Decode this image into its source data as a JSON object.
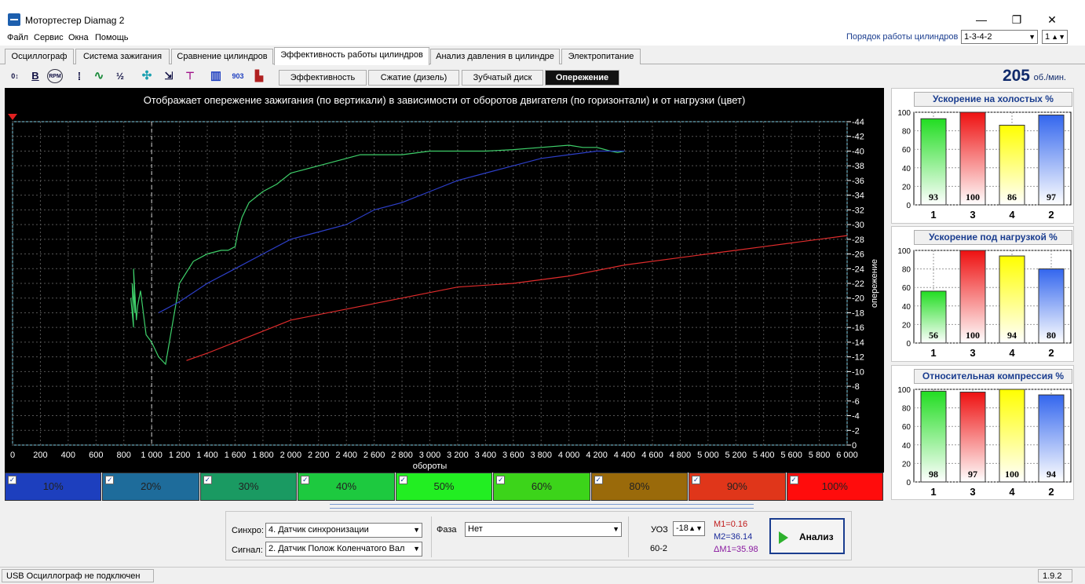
{
  "app": {
    "title": "Мотортестер Diamag 2",
    "window_controls": [
      "—",
      "❐",
      "✕"
    ]
  },
  "menu": [
    "Файл",
    "Сервис",
    "Окна",
    "Помощь"
  ],
  "cylinder_order": {
    "label": "Порядок работы цилиндров",
    "value": "1-3-4-2",
    "spinner_value": "1"
  },
  "tabs": [
    {
      "label": "Осциллограф"
    },
    {
      "label": "Система зажигания"
    },
    {
      "label": "Сравнение цилиндров"
    },
    {
      "label": "Эффективность работы цилиндров"
    },
    {
      "label": "Анализ давления в цилиндре"
    },
    {
      "label": "Электропитание"
    }
  ],
  "active_tab": "Эффективность работы цилиндров",
  "toolbar_icons": [
    {
      "name": "zero-adjust-icon",
      "glyph": "0↕"
    },
    {
      "name": "bold-icon",
      "glyph": "B"
    },
    {
      "name": "rpm-icon",
      "glyph": "RPM"
    },
    {
      "name": "scale-icon",
      "glyph": "⁞"
    },
    {
      "name": "curve-icon",
      "glyph": "∿"
    },
    {
      "name": "fraction-icon",
      "glyph": "½"
    },
    {
      "name": "fan-icon",
      "glyph": "✣"
    },
    {
      "name": "sort-icon",
      "glyph": "⇲"
    },
    {
      "name": "filter-icon",
      "glyph": "⊤"
    },
    {
      "name": "bars-icon",
      "glyph": "▥"
    },
    {
      "name": "degree-icon",
      "glyph": "903"
    },
    {
      "name": "level-icon",
      "glyph": "▙"
    }
  ],
  "subtabs": [
    {
      "label": "Эффективность"
    },
    {
      "label": "Сжатие (дизель)"
    },
    {
      "label": "Зубчатый диск"
    },
    {
      "label": "Опережение"
    }
  ],
  "active_subtab": "Опережение",
  "rpm": {
    "value": "205",
    "unit": "об./мин."
  },
  "colors": {
    "green_bar": "#22dd22",
    "red_bar": "#ee1111",
    "yellow_bar": "#ffff00",
    "blue_bar": "#3366ee",
    "chart_bg": "#000000",
    "grid": "#555555",
    "axis_text": "#ffffff"
  },
  "chart_data": [
    {
      "type": "line",
      "title": "Отображает опережение зажигания (по вертикали) в зависимости от оборотов двигателя (по горизонтали) и от нагрузки (цвет)",
      "xlabel": "обороты",
      "ylabel": "опережение",
      "xlim": [
        0,
        6000
      ],
      "ylim": [
        0,
        44
      ],
      "x_ticks": [
        "0",
        "200",
        "400",
        "600",
        "800",
        "1 000",
        "1 200",
        "1 400",
        "1 600",
        "1 800",
        "2 000",
        "2 200",
        "2 400",
        "2 600",
        "2 800",
        "3 000",
        "3 200",
        "3 400",
        "3 600",
        "3 800",
        "4 000",
        "4 200",
        "4 400",
        "4 600",
        "4 800",
        "5 000",
        "5 200",
        "5 400",
        "5 600",
        "5 800",
        "6 000"
      ],
      "y_ticks": [
        "0",
        "-2",
        "-4",
        "-6",
        "-8",
        "-10",
        "-12",
        "-14",
        "-16",
        "-18",
        "-20",
        "-22",
        "-24",
        "-26",
        "-28",
        "-30",
        "-32",
        "-34",
        "-36",
        "-38",
        "-40",
        "-42",
        "-44"
      ],
      "grid": true,
      "series": [
        {
          "color": "#3ecf6a",
          "x": [
            850,
            870,
            860,
            880,
            870,
            890,
            900,
            920,
            960,
            1000,
            1050,
            1100,
            1200,
            1300,
            1400,
            1500,
            1550,
            1600,
            1620,
            1650,
            1700,
            1800,
            1900,
            2000,
            2200,
            2400,
            2500,
            2600,
            2800,
            3000,
            3200,
            3400,
            3600,
            3800,
            4000,
            4100,
            4200,
            4300,
            4350,
            4400
          ],
          "y": [
            20,
            16,
            22,
            18,
            24,
            17,
            19,
            21,
            15,
            14,
            12,
            11,
            22,
            25,
            26,
            26.5,
            26.5,
            27,
            29,
            31,
            33,
            34.5,
            35.5,
            37,
            38,
            39,
            39.5,
            39.5,
            39.5,
            40,
            40,
            40,
            40.2,
            40.5,
            40.8,
            40.5,
            40.5,
            40,
            39.8,
            40
          ]
        },
        {
          "color": "#2d3fc8",
          "x": [
            1050,
            1100,
            1150,
            1200,
            1400,
            1600,
            1800,
            2000,
            2200,
            2400,
            2600,
            2800,
            3000,
            3200,
            3400,
            3600,
            3800,
            4000,
            4200,
            4300,
            4400
          ],
          "y": [
            18,
            18.5,
            19,
            19.5,
            22,
            24,
            26,
            28,
            29,
            30,
            32,
            33,
            34.5,
            36,
            37,
            38,
            39,
            39.5,
            40,
            40,
            40
          ]
        },
        {
          "color": "#e02c2c",
          "x": [
            1250,
            1400,
            1600,
            1800,
            2000,
            2400,
            2800,
            3200,
            3600,
            4000,
            4400,
            4800,
            5000,
            5200,
            5400,
            5600,
            5800,
            6000
          ],
          "y": [
            11.5,
            12.5,
            14,
            15.5,
            17,
            18.5,
            20,
            21.5,
            22,
            23,
            24.5,
            25.5,
            26,
            26.5,
            27,
            27.5,
            28,
            28.5
          ]
        }
      ]
    },
    {
      "type": "bar",
      "title": "Ускорение на холостых %",
      "categories": [
        "1",
        "3",
        "4",
        "2"
      ],
      "values": [
        93,
        100,
        86,
        97
      ],
      "ylim": [
        0,
        100
      ],
      "y_ticks": [
        "0",
        "20",
        "40",
        "60",
        "80",
        "100"
      ]
    },
    {
      "type": "bar",
      "title": "Ускорение под нагрузкой %",
      "categories": [
        "1",
        "3",
        "4",
        "2"
      ],
      "values": [
        56,
        100,
        94,
        80
      ],
      "ylim": [
        0,
        100
      ],
      "y_ticks": [
        "0",
        "20",
        "40",
        "60",
        "80",
        "100"
      ]
    },
    {
      "type": "bar",
      "title": "Относительная компрессия %",
      "categories": [
        "1",
        "3",
        "4",
        "2"
      ],
      "values": [
        98,
        97,
        100,
        94
      ],
      "ylim": [
        0,
        100
      ],
      "y_ticks": [
        "0",
        "20",
        "40",
        "60",
        "80",
        "100"
      ]
    }
  ],
  "load_buttons": [
    {
      "label": "10%",
      "color": "#1d3fbe",
      "checked": true
    },
    {
      "label": "20%",
      "color": "#1e6c9b",
      "checked": true
    },
    {
      "label": "30%",
      "color": "#1a9a62",
      "checked": true
    },
    {
      "label": "40%",
      "color": "#1dc93f",
      "checked": true
    },
    {
      "label": "50%",
      "color": "#22ee22",
      "checked": true
    },
    {
      "label": "60%",
      "color": "#3cd41a",
      "checked": true
    },
    {
      "label": "80%",
      "color": "#9a6a0a",
      "checked": true
    },
    {
      "label": "90%",
      "color": "#e0361a",
      "checked": true
    },
    {
      "label": "100%",
      "color": "#ff0c0c",
      "checked": true
    }
  ],
  "controls": {
    "sync_label": "Синхро:",
    "sync_value": "4.  Датчик синхронизации",
    "signal_label": "Сигнал:",
    "signal_value": "2.  Датчик Полож Коленчатого Вал",
    "phase_label": "Фаза",
    "phase_value": "Нет",
    "uoz_label": "УОЗ",
    "uoz_value": "-18",
    "wheel_label": "60-2",
    "m1": "M1=0.16",
    "m2": "M2=36.14",
    "dm1": "ΔM1=35.98",
    "analyze_label": "Анализ"
  },
  "status": {
    "text": "USB Осциллограф не подключен",
    "version": "1.9.2"
  }
}
